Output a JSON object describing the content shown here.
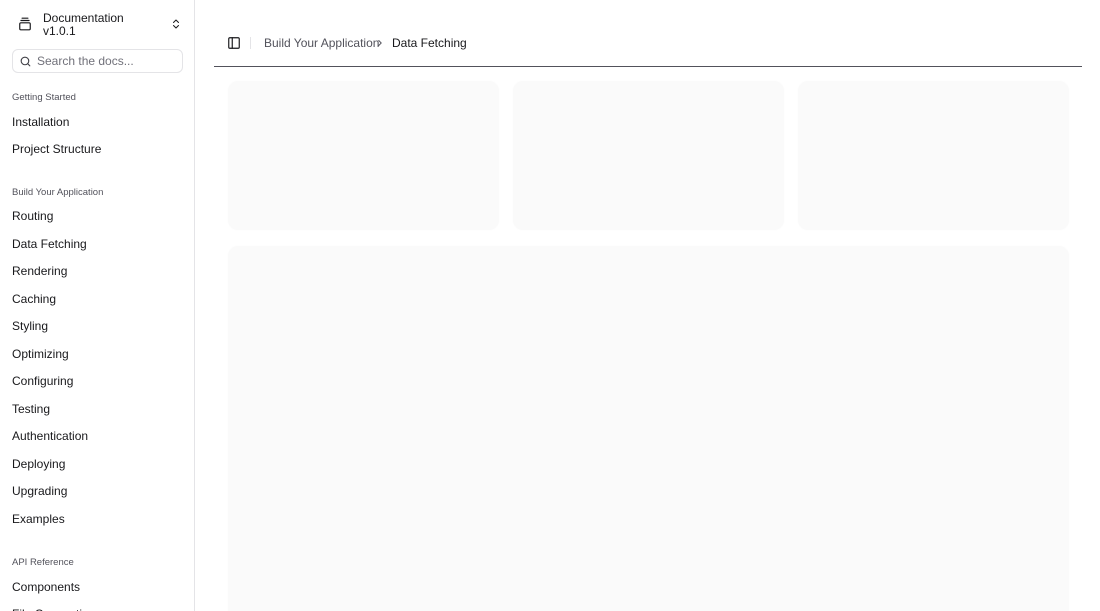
{
  "app": {
    "title": "Documentation",
    "version": "v1.0.1",
    "logo_icon": "gallery-vertical-end-icon",
    "switch_icon": "chevrons-up-down-icon"
  },
  "search": {
    "placeholder": "Search the docs...",
    "value": "",
    "icon": "search-icon"
  },
  "sidebar": {
    "groups": [
      {
        "label": "Getting Started",
        "items": [
          {
            "label": "Installation"
          },
          {
            "label": "Project Structure"
          }
        ]
      },
      {
        "label": "Build Your Application",
        "items": [
          {
            "label": "Routing"
          },
          {
            "label": "Data Fetching"
          },
          {
            "label": "Rendering"
          },
          {
            "label": "Caching"
          },
          {
            "label": "Styling"
          },
          {
            "label": "Optimizing"
          },
          {
            "label": "Configuring"
          },
          {
            "label": "Testing"
          },
          {
            "label": "Authentication"
          },
          {
            "label": "Deploying"
          },
          {
            "label": "Upgrading"
          },
          {
            "label": "Examples"
          }
        ]
      },
      {
        "label": "API Reference",
        "items": [
          {
            "label": "Components"
          },
          {
            "label": "File Conventions"
          }
        ]
      }
    ]
  },
  "header": {
    "toggle_icon": "panel-left-icon",
    "breadcrumb": {
      "parent": "Build Your Application",
      "separator_icon": "chevron-right-icon",
      "current": "Data Fetching"
    }
  },
  "colors": {
    "skeleton": "#fafafa",
    "border": "#e4e4e7",
    "text": "#18181b",
    "muted": "#52525b"
  }
}
